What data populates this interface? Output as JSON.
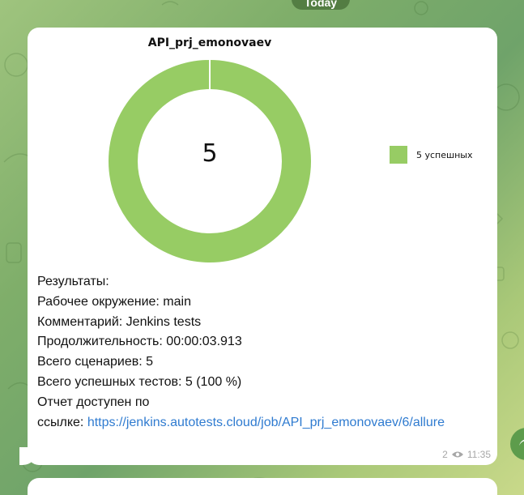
{
  "header": {
    "date_label": "Today"
  },
  "message": {
    "chart_title": "API_prj_emonovaev",
    "center_value": "5",
    "legend_label": "5 успешных",
    "lines": [
      {
        "key": "Результаты:",
        "value": ""
      },
      {
        "key": "Рабочее окружение:",
        "value": " main"
      },
      {
        "key": "Комментарий:",
        "value": " Jenkins tests"
      },
      {
        "key": "Продолжительность:",
        "value": " 00:00:03.913"
      },
      {
        "key": "Всего сценариев:",
        "value": " 5"
      },
      {
        "key": "Всего успешных тестов:",
        "value": " 5 (100 %)"
      }
    ],
    "report_text_1": "Отчет доступен по",
    "report_text_2": "ссылке:",
    "report_link": "https://jenkins.autotests.cloud/job/API_prj_emonovaev/6/allure",
    "views": "2",
    "time": "11:35"
  },
  "colors": {
    "success_green": "#97cc64",
    "link_blue": "#2f7bd0"
  },
  "icons": {
    "views": "eye-icon",
    "share": "share-icon"
  },
  "chart_data": {
    "type": "pie",
    "title": "API_prj_emonovaev",
    "categories": [
      "5 успешных"
    ],
    "values": [
      5
    ],
    "legend": "right"
  }
}
